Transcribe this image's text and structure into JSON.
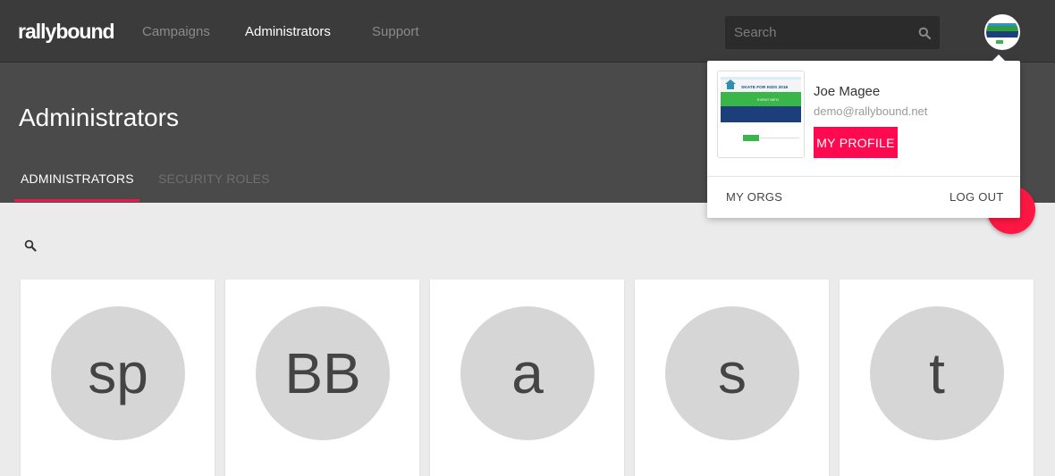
{
  "topnav": {
    "logo": "rallybound",
    "items": [
      {
        "label": "Campaigns",
        "active": false
      },
      {
        "label": "Administrators",
        "active": true
      },
      {
        "label": "Support",
        "active": false
      }
    ],
    "search_placeholder": "Search"
  },
  "header": {
    "title": "Administrators",
    "tabs": [
      {
        "label": "ADMINISTRATORS",
        "active": true
      },
      {
        "label": "SECURITY ROLES",
        "active": false
      }
    ]
  },
  "profile_menu": {
    "thumbnail_text": "SKATE FOR KIDS 2016",
    "thumbnail_banner": "EVENT INFO",
    "name": "Joe Magee",
    "email": "demo@rallybound.net",
    "profile_button": "MY PROFILE",
    "my_orgs": "MY ORGS",
    "log_out": "LOG OUT"
  },
  "admins": [
    {
      "initials": "sp"
    },
    {
      "initials": "BB"
    },
    {
      "initials": "a"
    },
    {
      "initials": "s"
    },
    {
      "initials": "t"
    }
  ],
  "colors": {
    "topbar": "#3b3b3b",
    "header": "#4a4a4a",
    "accent": "#ff0a50",
    "fab": "#ff1744",
    "avatar_bg": "#d6d6d6"
  }
}
